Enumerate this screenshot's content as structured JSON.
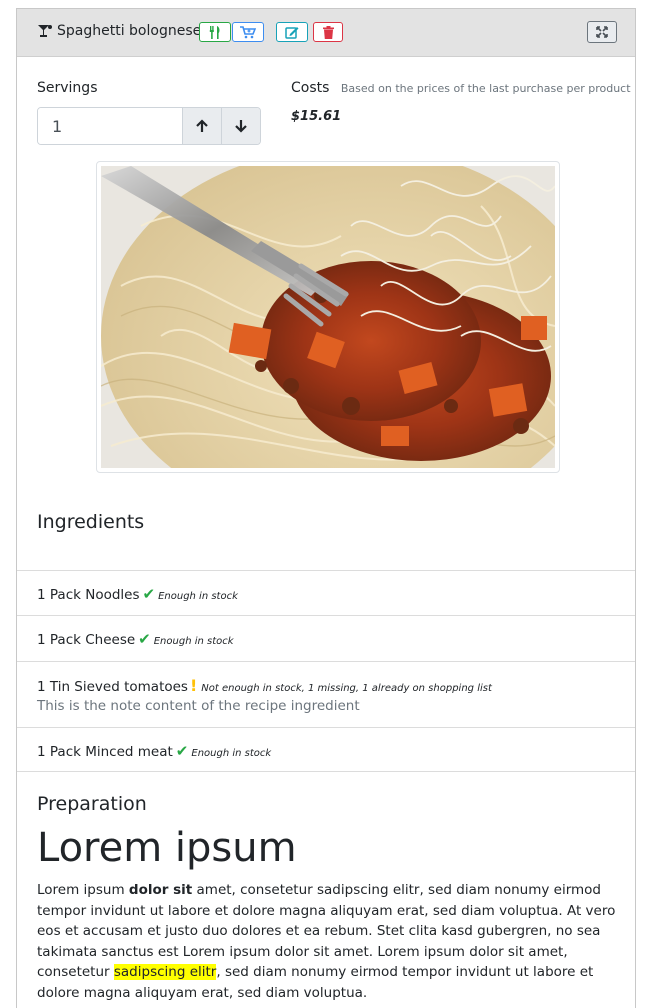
{
  "recipe": {
    "title": "Spaghetti bolognese",
    "icons": {
      "title": "cocktail-glass-icon",
      "consume": "utensils-icon",
      "shopping": "cart-plus-icon",
      "edit": "edit-icon",
      "delete": "trash-icon",
      "expand": "expand-icon"
    },
    "colors": {
      "green": "#28a745",
      "blue": "#3d8df0",
      "teal": "#17a2b8",
      "red": "#dc3545",
      "warning": "#ffc107"
    }
  },
  "servings": {
    "label": "Servings",
    "value": "1",
    "up_icon": "arrow-up-icon",
    "down_icon": "arrow-down-icon"
  },
  "costs": {
    "label": "Costs",
    "hint": "Based on the prices of the last purchase per product",
    "value": "$15.61"
  },
  "ingredients": {
    "heading": "Ingredients",
    "items": [
      {
        "text": "1 Pack Noodles",
        "status": "Enough in stock",
        "state": "ok"
      },
      {
        "text": "1 Pack Cheese",
        "status": "Enough in stock",
        "state": "ok"
      },
      {
        "text": "1 Tin Sieved tomatoes",
        "status": "Not enough in stock, 1 missing, 1 already on shopping list",
        "state": "warning",
        "note": "This is the note content of the recipe ingredient"
      },
      {
        "text": "1 Pack Minced meat",
        "status": "Enough in stock",
        "state": "ok"
      }
    ]
  },
  "preparation": {
    "heading": "Preparation",
    "title": "Lorem ipsum",
    "p1": "Lorem ipsum ",
    "bold": "dolor sit",
    "p2": " amet, consetetur sadipscing elitr, sed diam nonumy eirmod tempor invidunt ut labore et dolore magna aliquyam erat, sed diam voluptua. At vero eos et accusam et justo duo dolores et ea rebum. Stet clita kasd gubergren, no sea takimata sanctus est Lorem ipsum dolor sit amet. Lorem ipsum dolor sit amet, consetetur ",
    "highlight": "sadipscing elitr",
    "p3": ", sed diam nonumy eirmod tempor invidunt ut labore et dolore magna aliquyam erat, sed diam voluptua."
  }
}
